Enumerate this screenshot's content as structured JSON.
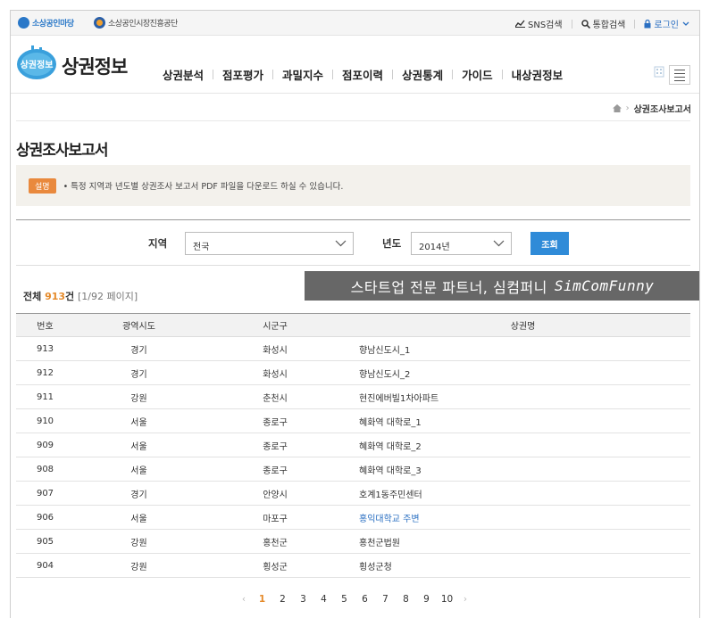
{
  "utilbar": {
    "logo1": "소상공인마당",
    "logo2": "소상공인시장진흥공단",
    "sns": "SNS검색",
    "search": "통합검색",
    "login": "로그인"
  },
  "header": {
    "badge": "상권정보",
    "title": "상권정보",
    "nav": [
      "상권분석",
      "점포평가",
      "과밀지수",
      "점포이력",
      "상권통계",
      "가이드",
      "내상권정보"
    ]
  },
  "breadcrumb": {
    "current": "상권조사보고서"
  },
  "page": {
    "title": "상권조사보고서",
    "info_tag": "설명",
    "info_text": "• 특정 지역과 년도별 상권조사 보고서 PDF 파일을 다운로드 하실 수 있습니다."
  },
  "search": {
    "region_label": "지역",
    "region_value": "전국",
    "year_label": "년도",
    "year_value": "2014년",
    "button": "조회"
  },
  "summary": {
    "prefix": "전체 ",
    "count": "913",
    "suffix": "건 ",
    "page_info": "[1/92 페이지]"
  },
  "watermark": {
    "ko": "스타트업 전문 파트너, 심컴퍼니",
    "en": "SimComFunny"
  },
  "table": {
    "headers": [
      "번호",
      "광역시도",
      "시군구",
      "상권명"
    ],
    "rows": [
      {
        "no": "913",
        "sido": "경기",
        "sgg": "화성시",
        "name": "향남신도시_1"
      },
      {
        "no": "912",
        "sido": "경기",
        "sgg": "화성시",
        "name": "향남신도시_2"
      },
      {
        "no": "911",
        "sido": "강원",
        "sgg": "춘천시",
        "name": "현진에버빌1차아파트"
      },
      {
        "no": "910",
        "sido": "서울",
        "sgg": "종로구",
        "name": "혜화역 대학로_1"
      },
      {
        "no": "909",
        "sido": "서울",
        "sgg": "종로구",
        "name": "혜화역 대학로_2"
      },
      {
        "no": "908",
        "sido": "서울",
        "sgg": "종로구",
        "name": "혜화역 대학로_3"
      },
      {
        "no": "907",
        "sido": "경기",
        "sgg": "안양시",
        "name": "호계1동주민센터"
      },
      {
        "no": "906",
        "sido": "서울",
        "sgg": "마포구",
        "name": "홍익대학교 주변"
      },
      {
        "no": "905",
        "sido": "강원",
        "sgg": "홍천군",
        "name": "홍천군법원"
      },
      {
        "no": "904",
        "sido": "강원",
        "sgg": "횡성군",
        "name": "횡성군청"
      }
    ]
  },
  "pager": {
    "prev": "‹",
    "next": "›",
    "pages": [
      "1",
      "2",
      "3",
      "4",
      "5",
      "6",
      "7",
      "8",
      "9",
      "10"
    ]
  }
}
